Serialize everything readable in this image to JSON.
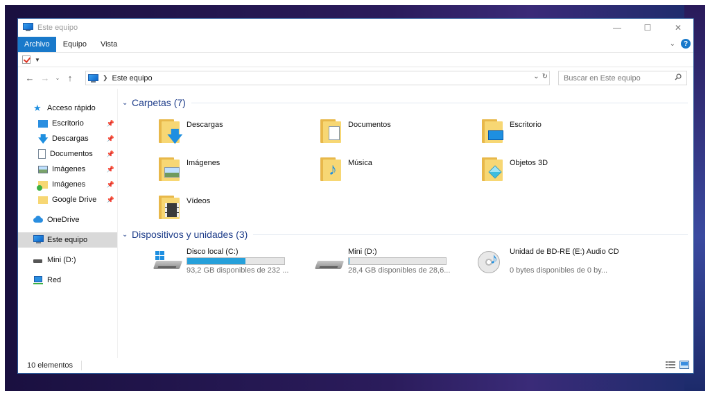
{
  "window": {
    "title": "Este equipo",
    "controls": {
      "minimize": "—",
      "maximize": "☐",
      "close": "✕"
    }
  },
  "ribbon": {
    "tabs": [
      "Archivo",
      "Equipo",
      "Vista"
    ],
    "help": "?"
  },
  "address": {
    "crumb": "Este equipo",
    "search_placeholder": "Buscar en Este equipo"
  },
  "nav_pane": {
    "quick_access": "Acceso rápido",
    "pinned": [
      "Escritorio",
      "Descargas",
      "Documentos",
      "Imágenes",
      "Imágenes",
      "Google Drive"
    ],
    "onedrive": "OneDrive",
    "this_pc": "Este equipo",
    "mini": "Mini (D:)",
    "network": "Red"
  },
  "folders_group": {
    "title": "Carpetas (7)",
    "items": [
      "Descargas",
      "Documentos",
      "Escritorio",
      "Imágenes",
      "Música",
      "Objetos 3D",
      "Vídeos"
    ]
  },
  "devices_group": {
    "title": "Dispositivos y unidades (3)",
    "drives": [
      {
        "name": "Disco local (C:)",
        "info": "93,2 GB disponibles de 232 ...",
        "used_fraction": 0.6
      },
      {
        "name": "Mini (D:)",
        "info": "28,4 GB disponibles de 28,6...",
        "used_fraction": 0.01
      },
      {
        "name": "Unidad de BD-RE (E:) Audio CD",
        "info": "0 bytes disponibles de 0 by..."
      }
    ]
  },
  "status": {
    "count": "10 elementos"
  },
  "colors": {
    "accent": "#1979ca",
    "group_title": "#1e3d8a",
    "drive_fill": "#26a0da",
    "folder": "#f7d774"
  }
}
